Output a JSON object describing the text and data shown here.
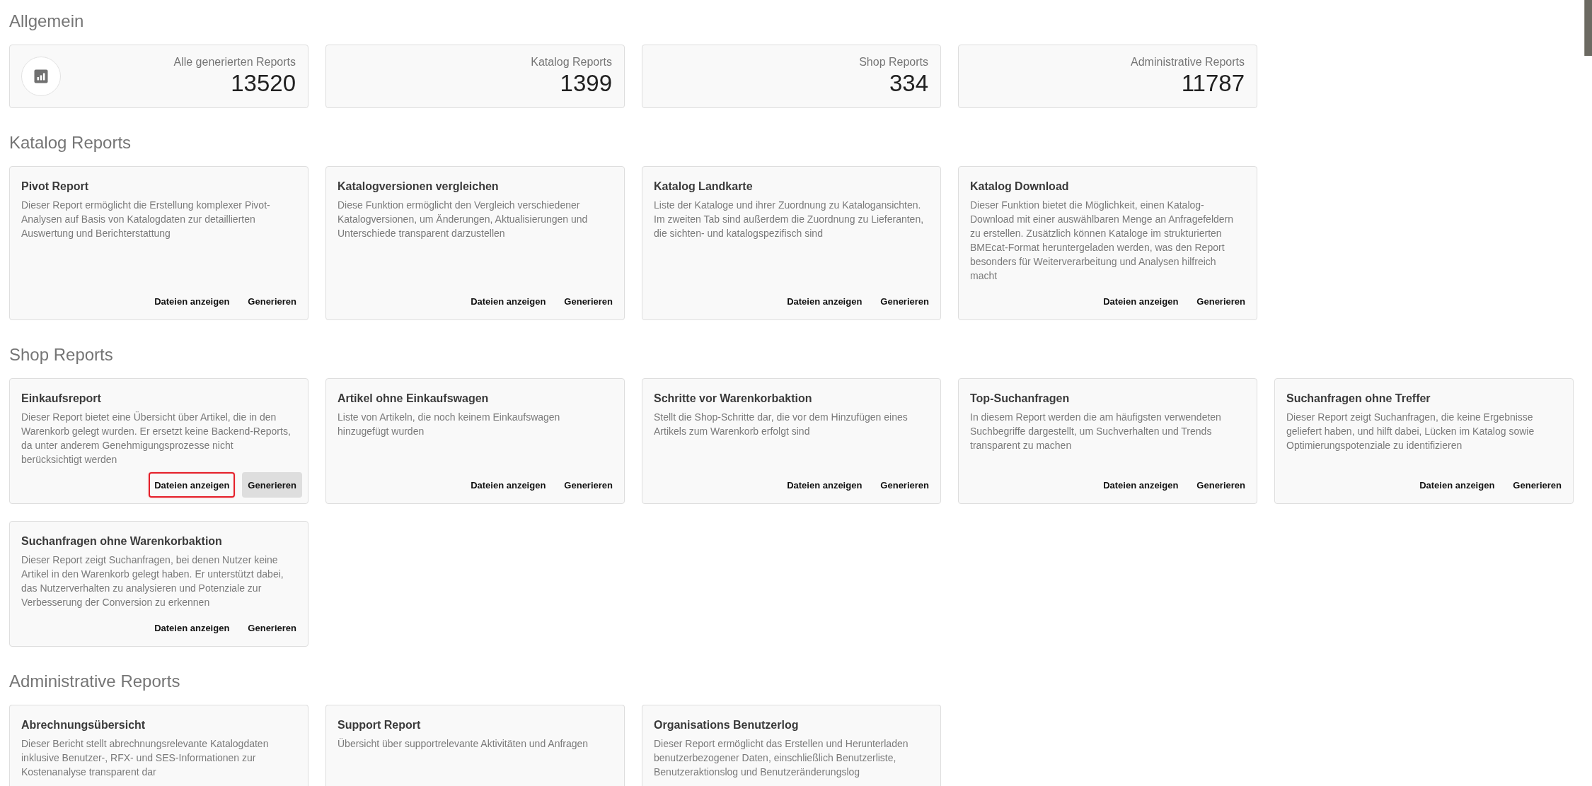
{
  "overview": {
    "heading": "Allgemein",
    "stats": [
      {
        "label": "Alle generierten Reports",
        "value": "13520",
        "icon": true
      },
      {
        "label": "Katalog Reports",
        "value": "1399",
        "icon": false
      },
      {
        "label": "Shop Reports",
        "value": "334",
        "icon": false
      },
      {
        "label": "Administrative Reports",
        "value": "11787",
        "icon": false
      }
    ]
  },
  "report_sections": [
    {
      "heading": "Katalog Reports",
      "cards": [
        {
          "title": "Pivot Report",
          "description": "Dieser Report ermöglicht die Erstellung komplexer Pivot-Analysen auf Basis von Katalogdaten zur detaillierten Auswertung und Berichterstattung",
          "actions": [
            {
              "label": "Dateien anzeigen",
              "focused": false,
              "hovered": false
            },
            {
              "label": "Generieren",
              "focused": false,
              "hovered": false
            }
          ]
        },
        {
          "title": "Katalogversionen vergleichen",
          "description": "Diese Funktion ermöglicht den Vergleich verschiedener Katalogversionen, um Änderungen, Aktualisierungen und Unterschiede transparent darzustellen",
          "actions": [
            {
              "label": "Dateien anzeigen",
              "focused": false,
              "hovered": false
            },
            {
              "label": "Generieren",
              "focused": false,
              "hovered": false
            }
          ]
        },
        {
          "title": "Katalog Landkarte",
          "description": "Liste der Kataloge und ihrer Zuordnung zu Katalogansichten. Im zweiten Tab sind außerdem die Zuordnung zu Lieferanten, die sichten- und katalogspezifisch sind",
          "actions": [
            {
              "label": "Dateien anzeigen",
              "focused": false,
              "hovered": false
            },
            {
              "label": "Generieren",
              "focused": false,
              "hovered": false
            }
          ]
        },
        {
          "title": "Katalog Download",
          "description": "Dieser Funktion bietet die Möglichkeit, einen Katalog-Download mit einer auswählbaren Menge an Anfragefeldern zu erstellen. Zusätzlich können Kataloge im strukturierten BMEcat-Format heruntergeladen werden, was den Report besonders für Weiterverarbeitung und Analysen hilfreich macht",
          "actions": [
            {
              "label": "Dateien anzeigen",
              "focused": false,
              "hovered": false
            },
            {
              "label": "Generieren",
              "focused": false,
              "hovered": false
            }
          ]
        }
      ]
    },
    {
      "heading": "Shop Reports",
      "cards": [
        {
          "title": "Einkaufsreport",
          "description": "Dieser Report bietet eine Übersicht über Artikel, die in den Warenkorb gelegt wurden. Er ersetzt keine Backend-Reports, da unter anderem Genehmigungsprozesse nicht berücksichtigt werden",
          "actions": [
            {
              "label": "Dateien anzeigen",
              "focused": true,
              "hovered": false
            },
            {
              "label": "Generieren",
              "focused": false,
              "hovered": true
            }
          ]
        },
        {
          "title": "Artikel ohne Einkaufswagen",
          "description": "Liste von Artikeln, die noch keinem Einkaufswagen hinzugefügt wurden",
          "actions": [
            {
              "label": "Dateien anzeigen",
              "focused": false,
              "hovered": false
            },
            {
              "label": "Generieren",
              "focused": false,
              "hovered": false
            }
          ]
        },
        {
          "title": "Schritte vor Warenkorbaktion",
          "description": "Stellt die Shop-Schritte dar, die vor dem Hinzufügen eines Artikels zum Warenkorb erfolgt sind",
          "actions": [
            {
              "label": "Dateien anzeigen",
              "focused": false,
              "hovered": false
            },
            {
              "label": "Generieren",
              "focused": false,
              "hovered": false
            }
          ]
        },
        {
          "title": "Top-Suchanfragen",
          "description": "In diesem Report werden die am häufigsten verwendeten Suchbegriffe dargestellt, um Suchverhalten und Trends transparent zu machen",
          "actions": [
            {
              "label": "Dateien anzeigen",
              "focused": false,
              "hovered": false
            },
            {
              "label": "Generieren",
              "focused": false,
              "hovered": false
            }
          ]
        },
        {
          "title": "Suchanfragen ohne Treffer",
          "description": "Dieser Report zeigt Suchanfragen, die keine Ergebnisse geliefert haben, und hilft dabei, Lücken im Katalog sowie Optimierungspotenziale zu identifizieren",
          "actions": [
            {
              "label": "Dateien anzeigen",
              "focused": false,
              "hovered": false
            },
            {
              "label": "Generieren",
              "focused": false,
              "hovered": false
            }
          ]
        },
        {
          "title": "Suchanfragen ohne Warenkorbaktion",
          "description": "Dieser Report zeigt Suchanfragen, bei denen Nutzer keine Artikel in den Warenkorb gelegt haben. Er unterstützt dabei, das Nutzerverhalten zu analysieren und Potenziale zur Verbesserung der Conversion zu erkennen",
          "actions": [
            {
              "label": "Dateien anzeigen",
              "focused": false,
              "hovered": false
            },
            {
              "label": "Generieren",
              "focused": false,
              "hovered": false
            }
          ]
        }
      ]
    },
    {
      "heading": "Administrative Reports",
      "cards": [
        {
          "title": "Abrechnungsübersicht",
          "description": "Dieser Bericht stellt abrechnungsrelevante Katalogdaten inklusive Benutzer-, RFX- und SES-Informationen zur Kostenanalyse transparent dar"
        },
        {
          "title": "Support Report",
          "description": "Übersicht über supportrelevante Aktivitäten und Anfragen"
        },
        {
          "title": "Organisations Benutzerlog",
          "description": "Dieser Report ermöglicht das Erstellen und Herunterladen benutzerbezogener Daten, einschließlich Benutzerliste, Benutzeraktionslog und Benutzeränderungslog"
        }
      ]
    }
  ]
}
